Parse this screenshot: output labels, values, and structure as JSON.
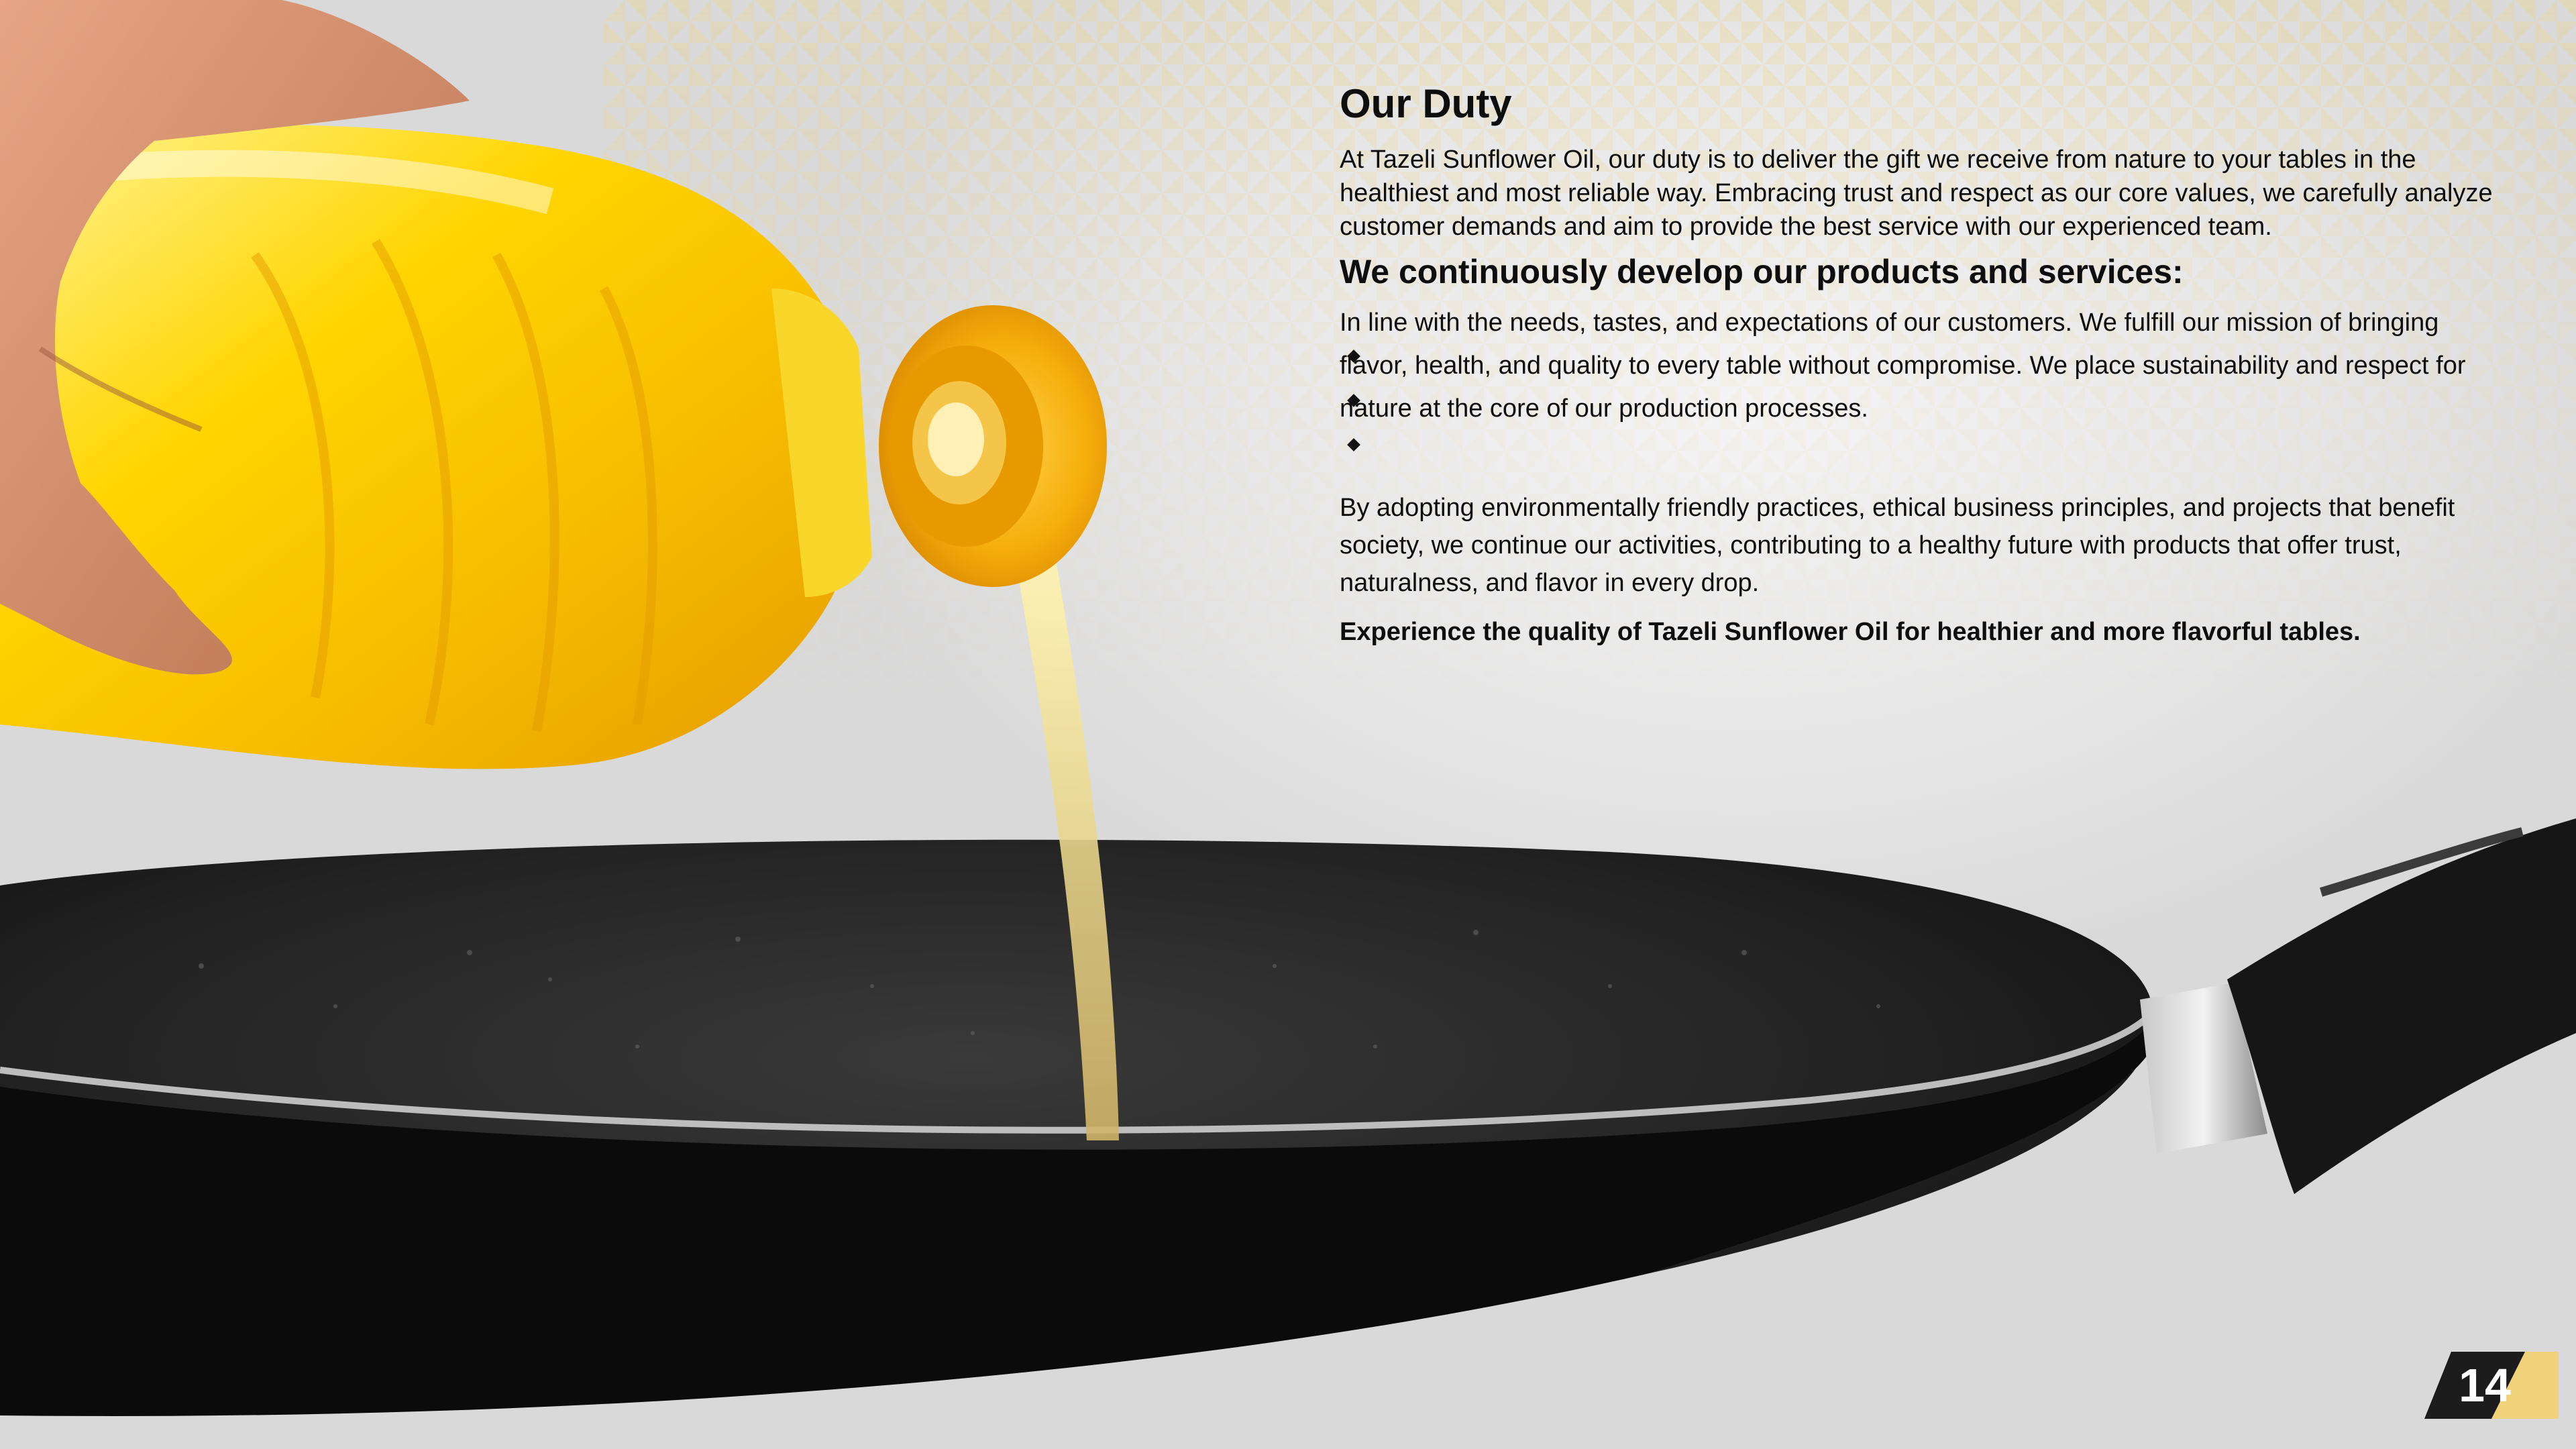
{
  "page": {
    "title": "Our Duty",
    "intro": "At Tazeli Sunflower Oil, our duty is to deliver the gift we receive from nature to your tables in the healthiest and most reliable way. Embracing trust and respect as our core values, we carefully analyze customer demands and aim to provide the best service with our experienced team.",
    "subheading": "We continuously develop our products and services:",
    "development_text": "In line with the needs, tastes, and expectations of our customers. We fulfill our mission of bringing flavor, health, and quality to every table without compromise. We place sustainability and respect for nature at the core of our production processes.",
    "sustainability_text": "By adopting environmentally friendly practices, ethical business principles, and projects that benefit society, we continue our activities, contributing to a healthy future with products that offer trust, naturalness, and flavor in every drop.",
    "closing": "Experience the quality of Tazeli Sunflower Oil for healthier and more flavorful tables.",
    "page_number": "14"
  },
  "colors": {
    "text": "#0e0e0e",
    "badge_dark": "#1c1c1c",
    "badge_accent": "#efd27a",
    "oil_yellow": "#f7c600",
    "cap_orange": "#f6ae0c",
    "pan": "#1e1e1e"
  },
  "icons": {
    "bullet": "diamond-bullet-icon"
  }
}
